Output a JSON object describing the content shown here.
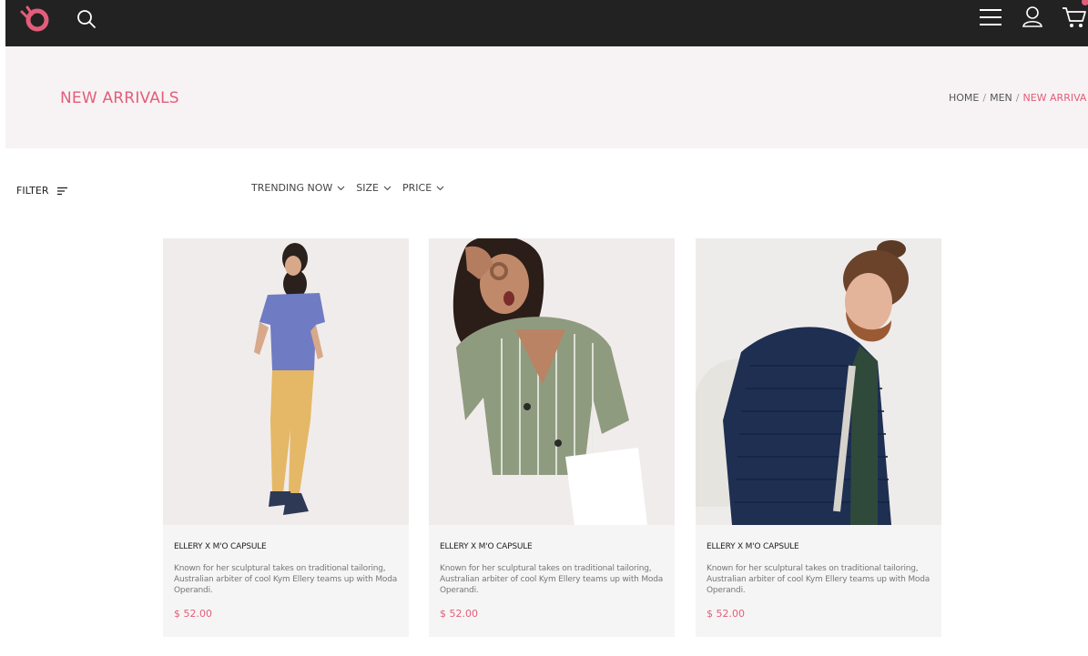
{
  "header": {
    "icons": [
      "logo-icon",
      "search-icon",
      "menu-icon",
      "user-icon",
      "cart-icon"
    ],
    "accent_color": "#e35d7a",
    "bar_color": "#222222"
  },
  "page": {
    "title": "NEW ARRIVALS",
    "breadcrumb": [
      "HOME",
      "MEN",
      "NEW ARRIVA"
    ]
  },
  "toolbar": {
    "filter_label": "FILTER",
    "sorts": [
      "TRENDING NOW",
      "SIZE",
      "PRICE"
    ]
  },
  "products": [
    {
      "name": "ELLERY X M'O CAPSULE",
      "description": "Known for her sculptural takes on traditional tailoring, Australian arbiter of cool Kym Ellery teams up with Moda Operandi.",
      "price": "$ 52.00"
    },
    {
      "name": "ELLERY X M'O CAPSULE",
      "description": "Known for her sculptural takes on traditional tailoring, Australian arbiter of cool Kym Ellery teams up with Moda Operandi.",
      "price": "$ 52.00"
    },
    {
      "name": "ELLERY X M'O CAPSULE",
      "description": "Known for her sculptural takes on traditional tailoring, Australian arbiter of cool Kym Ellery teams up with Moda Operandi.",
      "price": "$ 52.00"
    }
  ]
}
